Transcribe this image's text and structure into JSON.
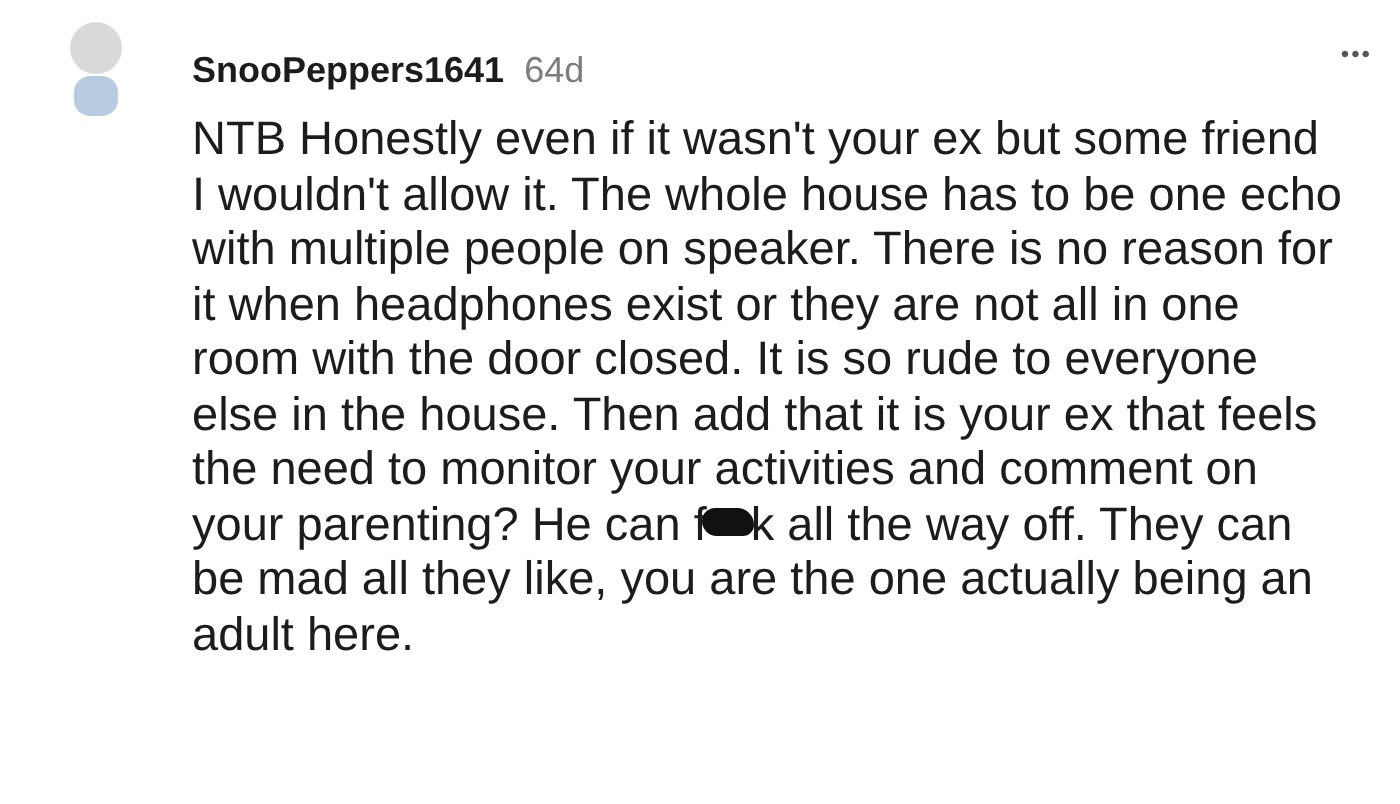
{
  "comment": {
    "username": "SnooPeppers1641",
    "age": "64d",
    "menu": "•••",
    "body_before": "NTB Honestly even if it wasn't your ex but some friend I wouldn't allow it. The whole house has to be one echo with multiple people on speaker. There is no reason for it when headphones exist or they are not all in one room with the door closed. It is so rude to everyone else in the house. Then add that it is your ex that feels the need to monitor your activities and comment on your parenting? He can f",
    "body_after": "k all the way off. They can be mad all they like, you are the one actually being an adult here."
  }
}
